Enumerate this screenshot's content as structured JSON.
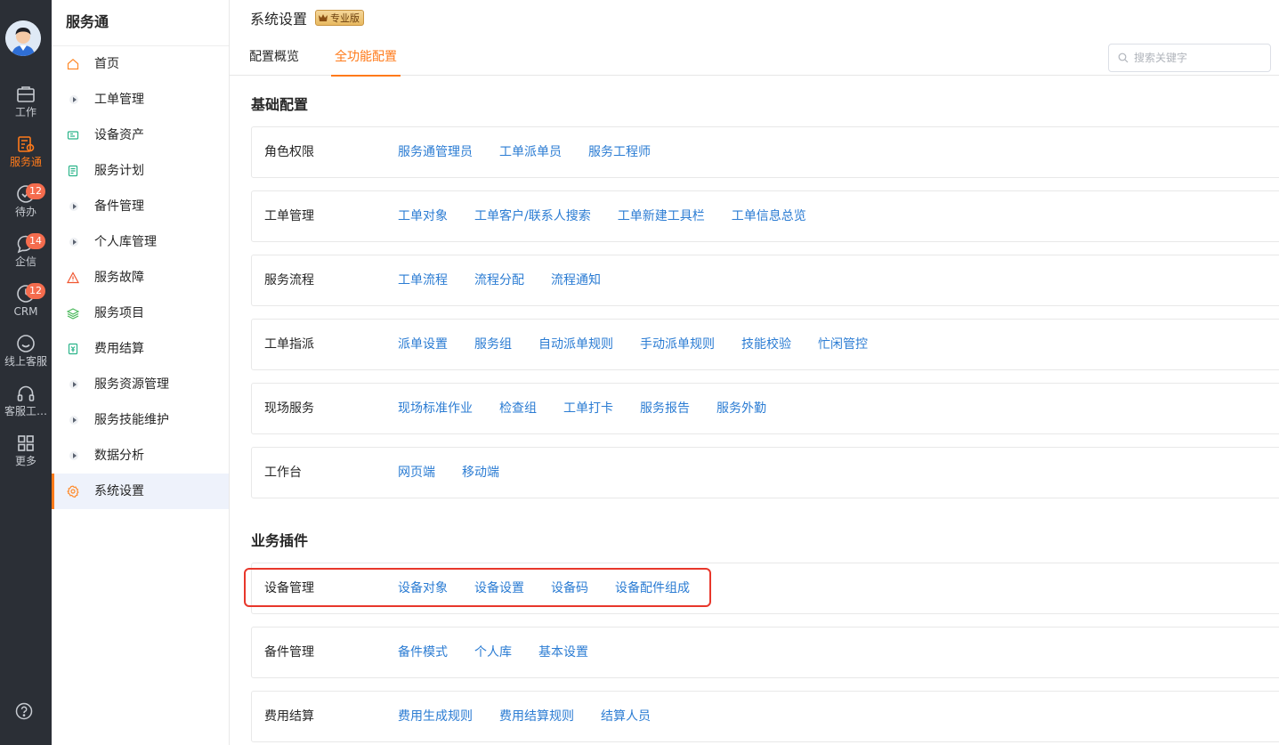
{
  "rail": {
    "items": [
      {
        "label": "工作",
        "icon": "briefcase-icon",
        "active": false
      },
      {
        "label": "服务通",
        "icon": "service-doc-icon",
        "active": true
      },
      {
        "label": "待办",
        "icon": "check-circle-icon",
        "badge": "12"
      },
      {
        "label": "企信",
        "icon": "chat-bubble-icon",
        "badge": "14"
      },
      {
        "label": "CRM",
        "icon": "clock-icon",
        "badge": "12"
      },
      {
        "label": "线上客服",
        "icon": "smile-icon"
      },
      {
        "label": "客服工…",
        "icon": "headset-icon"
      },
      {
        "label": "更多",
        "icon": "grid-icon"
      }
    ],
    "accent": "#ff7a1a"
  },
  "sidebar": {
    "title": "服务通",
    "items": [
      {
        "label": "首页",
        "icon": "home-icon"
      },
      {
        "label": "工单管理",
        "icon": "expand-arrow-icon"
      },
      {
        "label": "设备资产",
        "icon": "device-icon"
      },
      {
        "label": "服务计划",
        "icon": "plan-doc-icon"
      },
      {
        "label": "备件管理",
        "icon": "expand-arrow-icon"
      },
      {
        "label": "个人库管理",
        "icon": "expand-arrow-icon"
      },
      {
        "label": "服务故障",
        "icon": "warning-icon"
      },
      {
        "label": "服务项目",
        "icon": "layers-icon"
      },
      {
        "label": "费用结算",
        "icon": "money-icon"
      },
      {
        "label": "服务资源管理",
        "icon": "expand-arrow-icon"
      },
      {
        "label": "服务技能维护",
        "icon": "expand-arrow-icon"
      },
      {
        "label": "数据分析",
        "icon": "expand-arrow-icon"
      },
      {
        "label": "系统设置",
        "icon": "settings-gear-icon",
        "active": true
      }
    ]
  },
  "header": {
    "title": "系统设置",
    "badge": "专业版"
  },
  "tabs": [
    {
      "label": "配置概览",
      "active": false
    },
    {
      "label": "全功能配置",
      "active": true
    }
  ],
  "search": {
    "placeholder": "搜索关键字"
  },
  "sections": [
    {
      "title": "基础配置",
      "cards": [
        {
          "label": "角色权限",
          "links": [
            "服务通管理员",
            "工单派单员",
            "服务工程师"
          ]
        },
        {
          "label": "工单管理",
          "links": [
            "工单对象",
            "工单客户/联系人搜索",
            "工单新建工具栏",
            "工单信息总览"
          ]
        },
        {
          "label": "服务流程",
          "links": [
            "工单流程",
            "流程分配",
            "流程通知"
          ]
        },
        {
          "label": "工单指派",
          "links": [
            "派单设置",
            "服务组",
            "自动派单规则",
            "手动派单规则",
            "技能校验",
            "忙闲管控"
          ]
        },
        {
          "label": "现场服务",
          "links": [
            "现场标准作业",
            "检查组",
            "工单打卡",
            "服务报告",
            "服务外勤"
          ]
        },
        {
          "label": "工作台",
          "links": [
            "网页端",
            "移动端"
          ]
        }
      ]
    },
    {
      "title": "业务插件",
      "cards": [
        {
          "label": "设备管理",
          "links": [
            "设备对象",
            "设备设置",
            "设备码",
            "设备配件组成"
          ],
          "highlighted": true
        },
        {
          "label": "备件管理",
          "links": [
            "备件模式",
            "个人库",
            "基本设置"
          ]
        },
        {
          "label": "费用结算",
          "links": [
            "费用生成规则",
            "费用结算规则",
            "结算人员"
          ]
        }
      ]
    }
  ],
  "colors": {
    "link": "#2b7cd3",
    "highlight": "#e8372b",
    "rail_bg": "#2b2f36"
  }
}
